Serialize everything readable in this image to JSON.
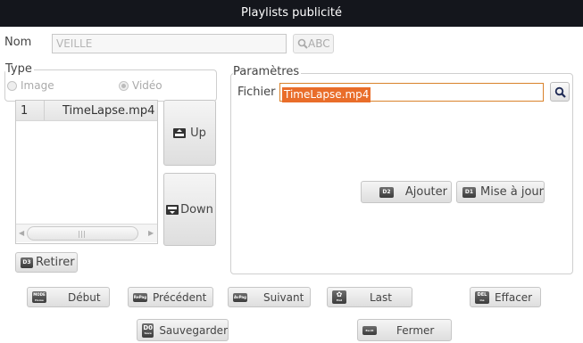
{
  "window": {
    "title": "Playlists publicité"
  },
  "nom": {
    "label": "Nom",
    "value": "VEILLE",
    "abc_button": "ABC"
  },
  "type": {
    "group_label": "Type",
    "options": [
      {
        "label": "Image",
        "selected": false
      },
      {
        "label": "Vidéo",
        "selected": true
      }
    ]
  },
  "playlist": {
    "rows": [
      {
        "index": "1",
        "file": "TimeLapse.mp4"
      }
    ]
  },
  "buttons": {
    "up": "Up",
    "down": "Down",
    "retirer": "Retirer",
    "retirer_key": "D3"
  },
  "parametres": {
    "group_label": "Paramètres",
    "fichier_label": "Fichier",
    "fichier_value": "TimeLapse.mp4",
    "ajouter": "Ajouter",
    "ajouter_key": "D2",
    "mise_a_jour": "Mise à jour",
    "mise_a_jour_key": "D1"
  },
  "footer": {
    "debut": "Début",
    "debut_key": [
      "MODE",
      "Home"
    ],
    "precedent": "Précédent",
    "precedent_key": "RePag",
    "suivant": "Suivant",
    "suivant_key": "AvPag",
    "last": "Last",
    "last_key": "End",
    "effacer": "Effacer",
    "effacer_key": [
      "DEL",
      "Ins"
    ],
    "sauvegarder": "Sauvegarder",
    "sauvegarder_key": [
      "D0",
      "Save"
    ],
    "fermer": "Fermer",
    "fermer_key": "Esc/K"
  },
  "colors": {
    "titlebar": "#14161c",
    "selection": "#e96d2a"
  }
}
